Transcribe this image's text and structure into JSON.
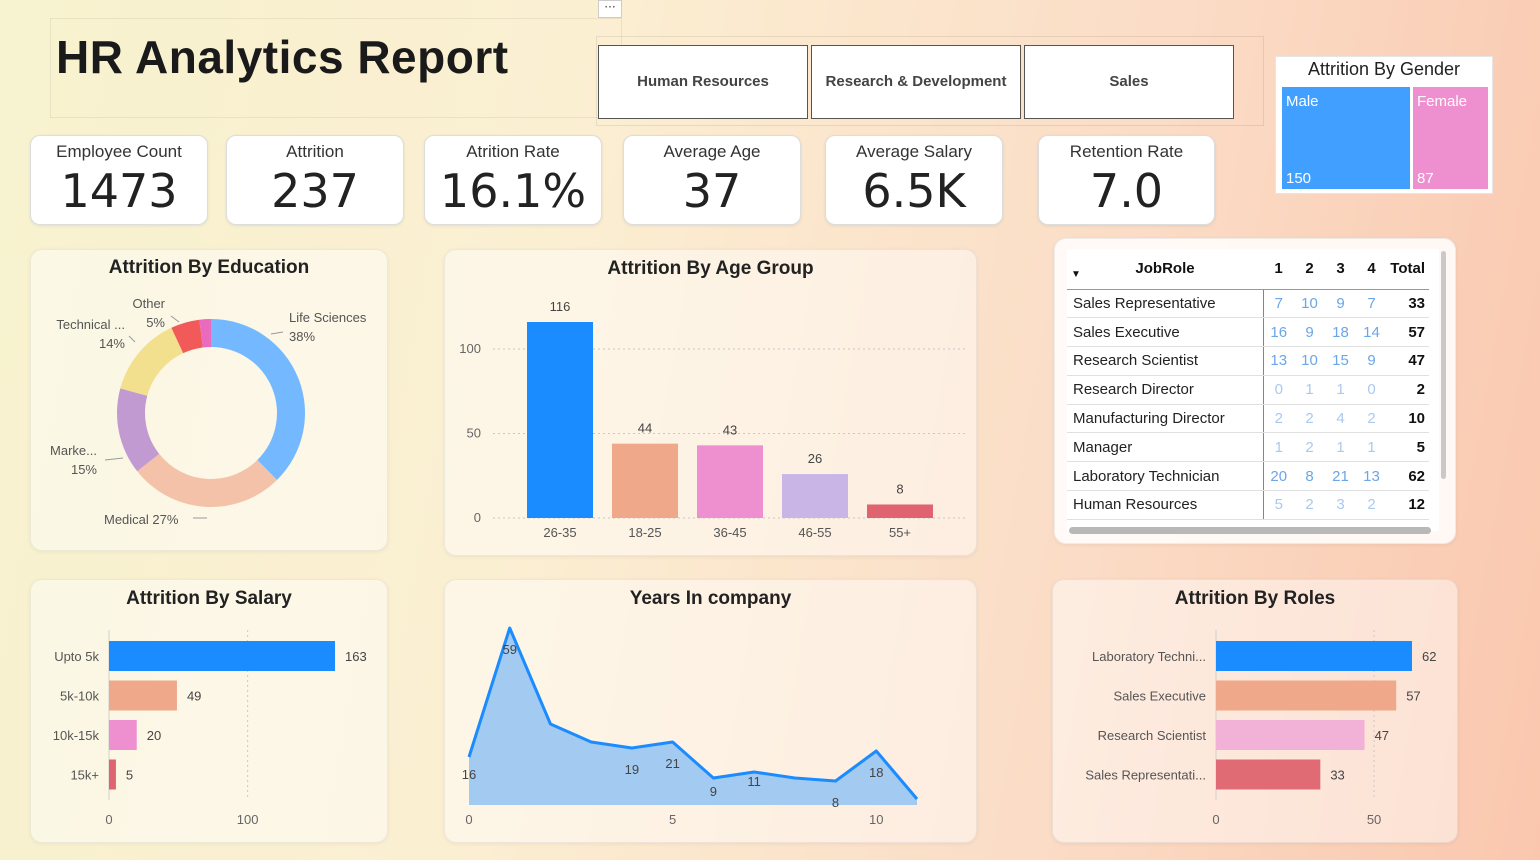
{
  "header": {
    "title": "HR Analytics Report",
    "menu_glyph": "···"
  },
  "slicers": [
    {
      "label": "Human Resources"
    },
    {
      "label": "Research & Development"
    },
    {
      "label": "Sales"
    }
  ],
  "kpis": [
    {
      "label": "Employee Count",
      "value": "1473"
    },
    {
      "label": "Attrition",
      "value": "237"
    },
    {
      "label": "Atrition Rate",
      "value": "16.1%"
    },
    {
      "label": "Average Age",
      "value": "37"
    },
    {
      "label": "Average Salary",
      "value": "6.5K"
    },
    {
      "label": "Retention Rate",
      "value": "7.0"
    }
  ],
  "gender": {
    "title": "Attrition By Gender",
    "cells": [
      {
        "name": "Male",
        "value": "150",
        "color": "#41a0ff"
      },
      {
        "name": "Female",
        "value": "87",
        "color": "#ee8fcf"
      }
    ]
  },
  "jobs_table": {
    "headers": [
      "JobRole",
      "1",
      "2",
      "3",
      "4",
      "Total"
    ],
    "sort_icon": "sort-down-icon",
    "rows": [
      {
        "role": "Sales Representative",
        "v": [
          "7",
          "10",
          "9",
          "7"
        ],
        "total": "33"
      },
      {
        "role": "Sales Executive",
        "v": [
          "16",
          "9",
          "18",
          "14"
        ],
        "total": "57"
      },
      {
        "role": "Research Scientist",
        "v": [
          "13",
          "10",
          "15",
          "9"
        ],
        "total": "47"
      },
      {
        "role": "Research Director",
        "v": [
          "0",
          "1",
          "1",
          "0"
        ],
        "total": "2"
      },
      {
        "role": "Manufacturing Director",
        "v": [
          "2",
          "2",
          "4",
          "2"
        ],
        "total": "10"
      },
      {
        "role": "Manager",
        "v": [
          "1",
          "2",
          "1",
          "1"
        ],
        "total": "5"
      },
      {
        "role": "Laboratory Technician",
        "v": [
          "20",
          "8",
          "21",
          "13"
        ],
        "total": "62"
      },
      {
        "role": "Human Resources",
        "v": [
          "5",
          "2",
          "3",
          "2"
        ],
        "total": "12"
      }
    ]
  },
  "chart_data": [
    {
      "id": "education",
      "type": "pie",
      "title": "Attrition By Education",
      "categories": [
        "Life Sciences",
        "Medical",
        "Marke...",
        "Technical ...",
        "Other",
        ""
      ],
      "values": [
        38,
        27,
        15,
        14,
        5,
        2
      ],
      "labels": [
        "Life Sciences\n38%",
        "Medical 27%",
        "Marke...\n15%",
        "Technical ...\n14%",
        "Other\n5%",
        ""
      ],
      "colors": [
        "#74b9ff",
        "#f4c2a8",
        "#c29ad2",
        "#f2e08f",
        "#f25a5a",
        "#ea6bbd"
      ]
    },
    {
      "id": "age",
      "type": "bar",
      "title": "Attrition By Age Group",
      "categories": [
        "26-35",
        "18-25",
        "36-45",
        "46-55",
        "55+"
      ],
      "values": [
        116,
        44,
        43,
        26,
        8
      ],
      "ylim": [
        0,
        116
      ],
      "yticks": [
        0,
        50,
        100
      ],
      "colors": [
        "#1a8cff",
        "#efa88a",
        "#ee8fcf",
        "#c9b6e6",
        "#e06370"
      ],
      "grid": true
    },
    {
      "id": "salary",
      "type": "bar",
      "orientation": "horizontal",
      "title": "Attrition By Salary",
      "categories": [
        "Upto 5k",
        "5k-10k",
        "10k-15k",
        "15k+"
      ],
      "values": [
        163,
        49,
        20,
        5
      ],
      "xlim": [
        0,
        163
      ],
      "xticks": [
        0,
        100
      ],
      "colors": [
        "#1a8cff",
        "#efa88a",
        "#ee8fcf",
        "#e06370"
      ],
      "grid": true
    },
    {
      "id": "years",
      "type": "area",
      "title": "Years In company",
      "x": [
        0,
        1,
        2,
        3,
        4,
        5,
        6,
        7,
        8,
        9,
        10,
        11
      ],
      "values": [
        16,
        59,
        27,
        21,
        19,
        21,
        9,
        11,
        9,
        8,
        18,
        2
      ],
      "labels": [
        "16",
        "59",
        "",
        "",
        "19",
        "21",
        "9",
        "11",
        "",
        "8",
        "18",
        ""
      ],
      "xlim": [
        0,
        11
      ],
      "xticks": [
        0,
        5,
        10
      ],
      "ylim": [
        0,
        59
      ],
      "colors": [
        "#1a8cff",
        "#a3caf0"
      ]
    },
    {
      "id": "roles",
      "type": "bar",
      "orientation": "horizontal",
      "title": "Attrition By Roles",
      "categories": [
        "Laboratory Techni...",
        "Sales Executive",
        "Research Scientist",
        "Sales Representati..."
      ],
      "values": [
        62,
        57,
        47,
        33
      ],
      "xlim": [
        0,
        62
      ],
      "xticks": [
        0,
        50
      ],
      "colors": [
        "#1a8cff",
        "#efa88a",
        "#f2b2d8",
        "#e06b75"
      ],
      "grid": true
    }
  ]
}
